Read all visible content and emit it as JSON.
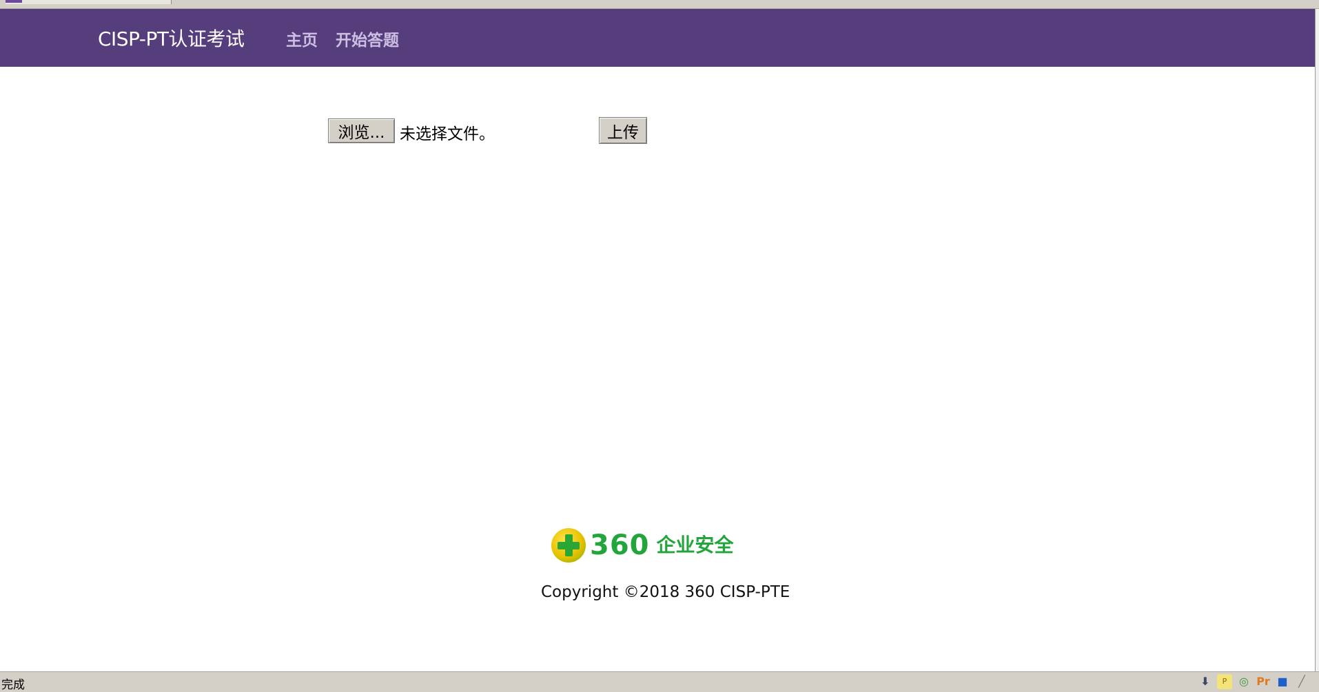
{
  "navbar": {
    "brand": "CISP-PT认证考试",
    "links": [
      "主页",
      "开始答题"
    ]
  },
  "upload_form": {
    "browse_label": "浏览...",
    "file_status": "未选择文件。",
    "upload_label": "上传"
  },
  "footer": {
    "logo_number": "360",
    "logo_text": "企业安全",
    "copyright": "Copyright ©2018 360 CISP-PTE"
  },
  "statusbar": {
    "text": "完成",
    "tray_icons": [
      "download-arrow-icon",
      "p-badge-icon",
      "globe-icon",
      "pr-icon",
      "flag-icon",
      "resize-grip-icon"
    ]
  },
  "colors": {
    "navbar_bg": "#563d7c",
    "nav_link": "#cdbfe3",
    "logo_green": "#22a53a",
    "logo_yellow": "#e6c200",
    "chrome_gray": "#d4d0c8"
  }
}
